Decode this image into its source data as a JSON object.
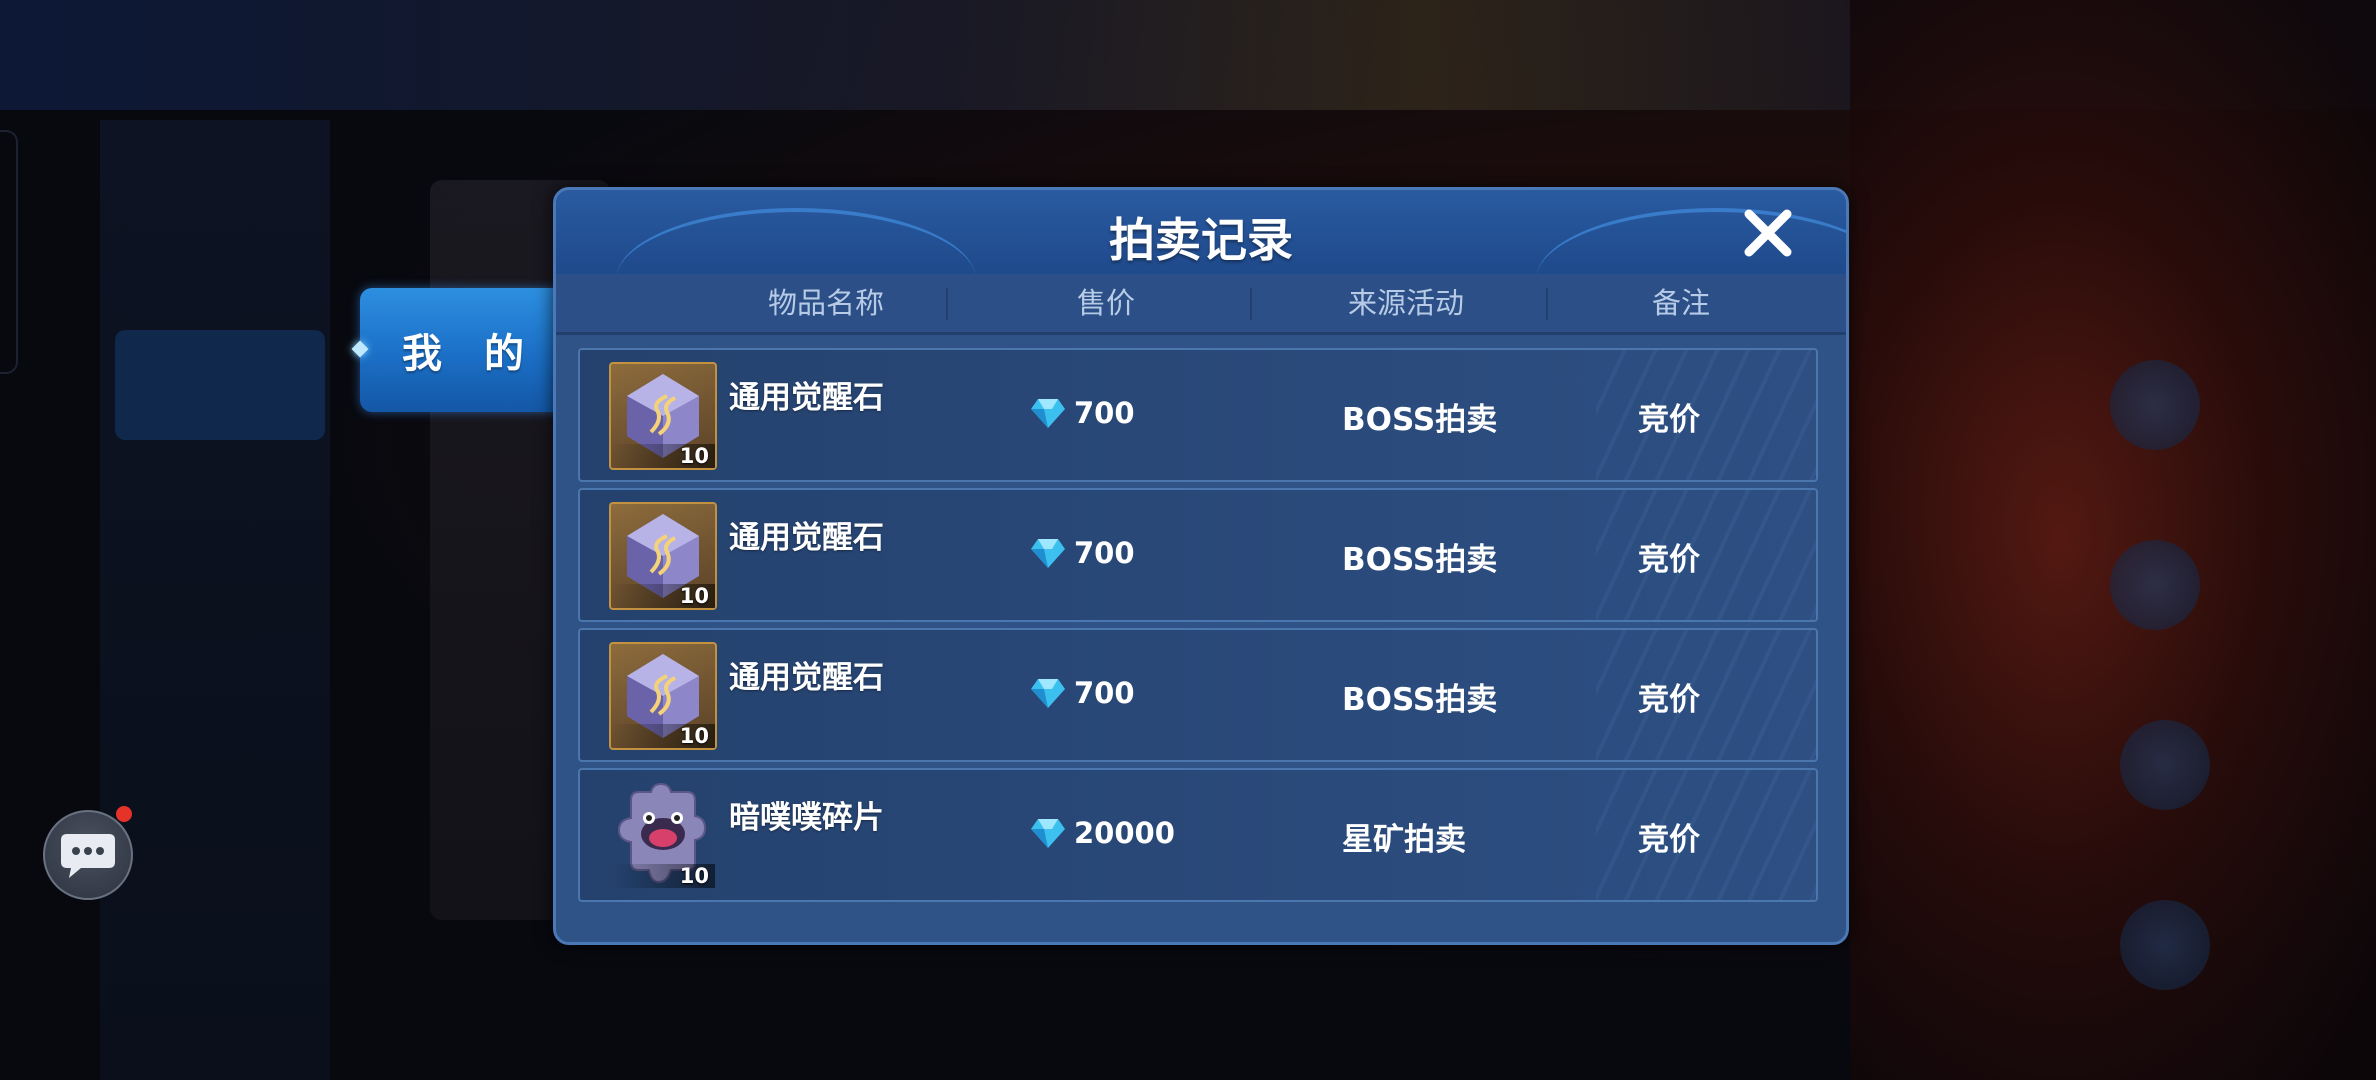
{
  "tab": {
    "label": "我 的"
  },
  "dialog": {
    "title": "拍卖记录",
    "columns": [
      "物品名称",
      "售价",
      "来源活动",
      "备注"
    ]
  },
  "records": [
    {
      "name": "通用觉醒石",
      "count": "10",
      "price": "700",
      "source": "BOSS拍卖",
      "note": "竞价",
      "icon": "awakening-stone-icon"
    },
    {
      "name": "通用觉醒石",
      "count": "10",
      "price": "700",
      "source": "BOSS拍卖",
      "note": "竞价",
      "icon": "awakening-stone-icon"
    },
    {
      "name": "通用觉醒石",
      "count": "10",
      "price": "700",
      "source": "BOSS拍卖",
      "note": "竞价",
      "icon": "awakening-stone-icon"
    },
    {
      "name": "暗噗噗碎片",
      "count": "10",
      "price": "20000",
      "source": "星矿拍卖",
      "note": "竞价",
      "icon": "dark-pupu-fragment-icon"
    }
  ],
  "colors": {
    "dialog_bg": "#2f5287",
    "tab_blue": "#1b6fc6",
    "gem": "#3cc0f0",
    "notification": "#e5332a"
  }
}
